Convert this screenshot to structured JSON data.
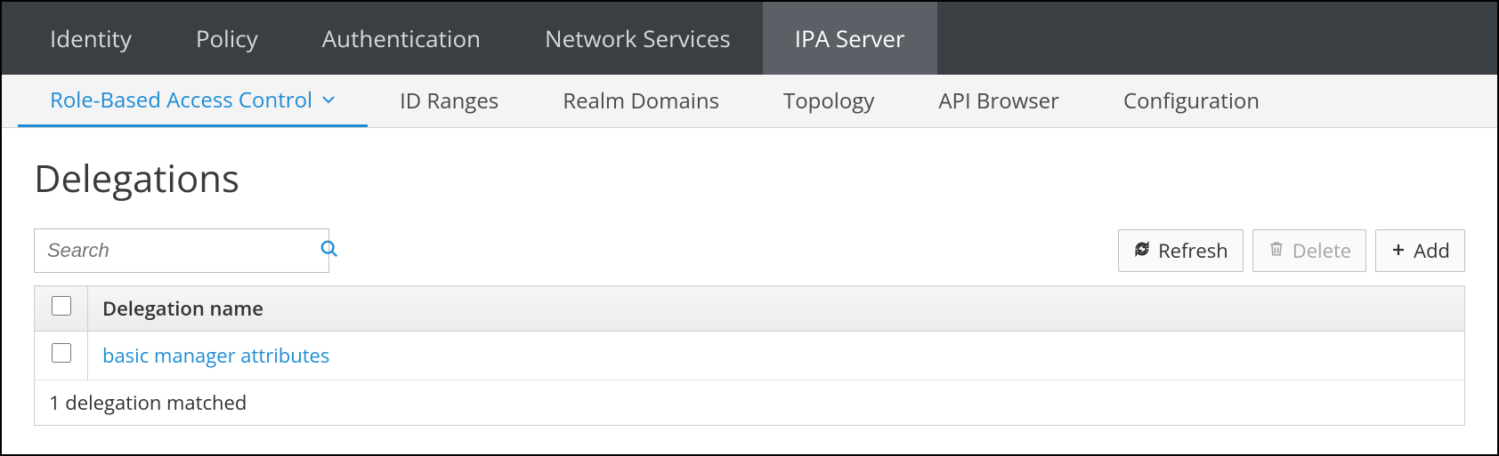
{
  "topnav": {
    "items": [
      {
        "label": "Identity"
      },
      {
        "label": "Policy"
      },
      {
        "label": "Authentication"
      },
      {
        "label": "Network Services"
      },
      {
        "label": "IPA Server",
        "active": true
      }
    ]
  },
  "subnav": {
    "items": [
      {
        "label": "Role-Based Access Control",
        "active": true,
        "dropdown": true
      },
      {
        "label": "ID Ranges"
      },
      {
        "label": "Realm Domains"
      },
      {
        "label": "Topology"
      },
      {
        "label": "API Browser"
      },
      {
        "label": "Configuration"
      }
    ]
  },
  "page": {
    "title": "Delegations"
  },
  "search": {
    "placeholder": "Search"
  },
  "buttons": {
    "refresh": "Refresh",
    "delete": "Delete",
    "add": "Add"
  },
  "table": {
    "header": {
      "col1": "Delegation name"
    },
    "rows": [
      {
        "name": "basic manager attributes"
      }
    ],
    "footer": "1 delegation matched"
  },
  "colors": {
    "accent": "#1f8dd6"
  }
}
